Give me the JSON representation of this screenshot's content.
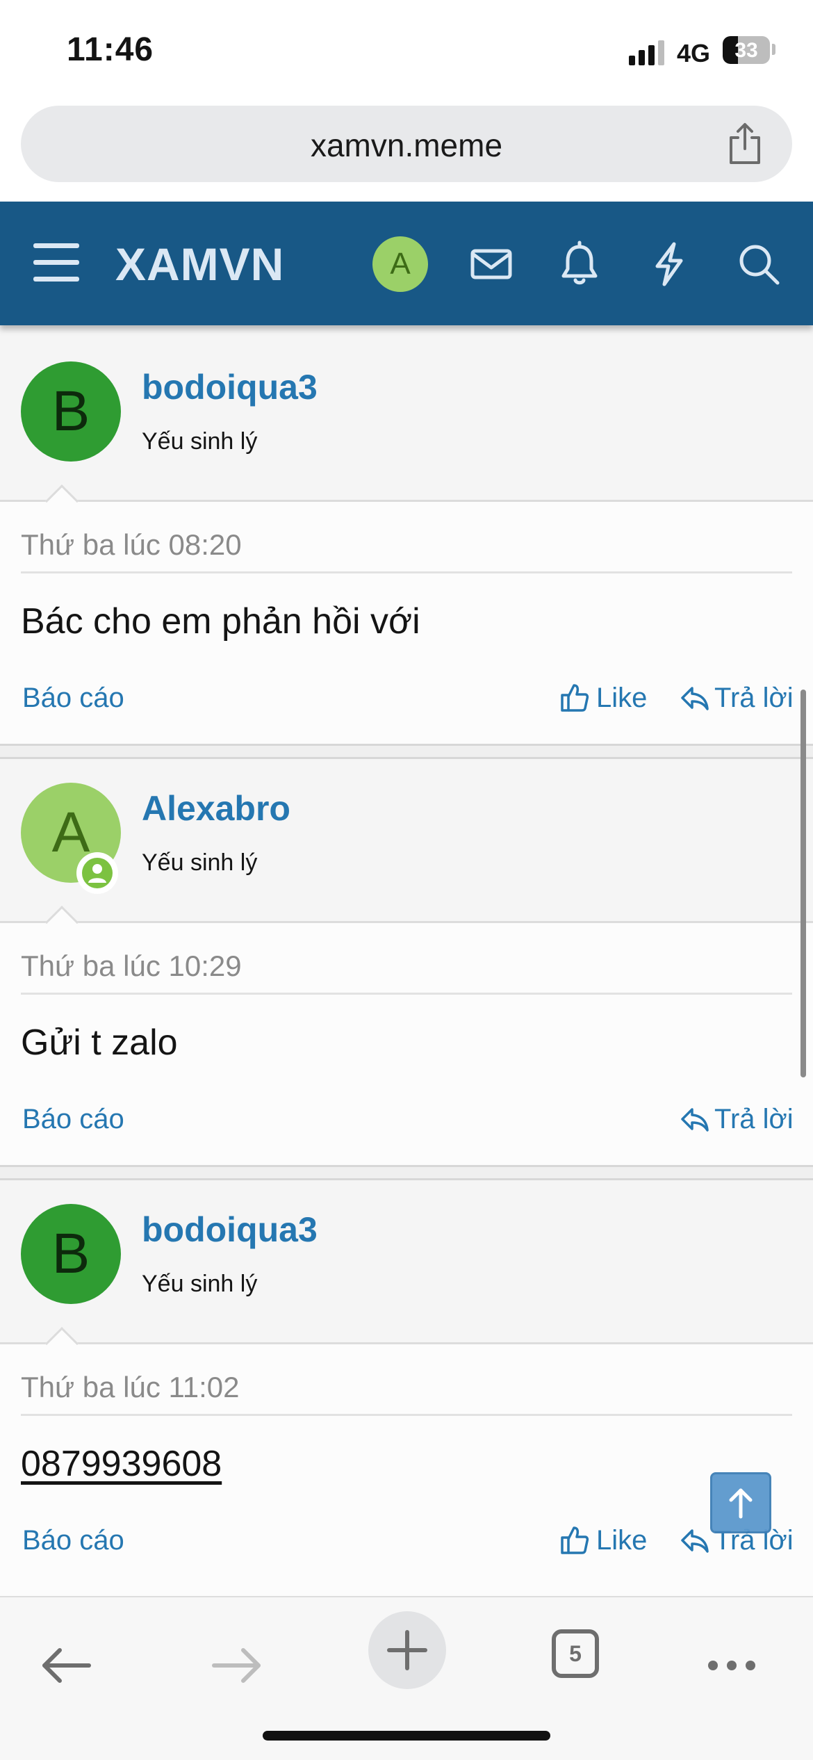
{
  "status": {
    "time": "11:46",
    "network": "4G",
    "battery": "33"
  },
  "browser": {
    "url": "xamvn.meme",
    "tabs_count": "5"
  },
  "header": {
    "logo": "XAMVN",
    "avatar_letter": "A"
  },
  "posts": [
    {
      "avatar_letter": "B",
      "username": "bodoiqua3",
      "user_title": "Yếu sinh lý",
      "date": "Thứ ba lúc 08:20",
      "body": "Bác cho em phản hồi với",
      "report": "Báo cáo",
      "like": "Like",
      "reply": "Trả lời"
    },
    {
      "avatar_letter": "A",
      "username": "Alexabro",
      "user_title": "Yếu sinh lý",
      "date": "Thứ ba lúc 10:29",
      "body": "Gửi t zalo",
      "report": "Báo cáo",
      "reply": "Trả lời"
    },
    {
      "avatar_letter": "B",
      "username": "bodoiqua3",
      "user_title": "Yếu sinh lý",
      "date": "Thứ ba lúc 11:02",
      "body": "0879939608",
      "report": "Báo cáo",
      "like": "Like",
      "reply": "Trả lời"
    }
  ],
  "colors": {
    "header_bg": "#185886",
    "link": "#2577b1",
    "avatar_green": "#2f9c32",
    "avatar_lime": "#9bd068"
  },
  "icons": [
    "hamburger-icon",
    "mail-icon",
    "bell-icon",
    "lightning-icon",
    "search-icon",
    "share-icon",
    "thumbs-up-icon",
    "reply-icon",
    "arrow-up-icon",
    "back-arrow-icon",
    "forward-arrow-icon",
    "plus-icon",
    "more-icon"
  ]
}
